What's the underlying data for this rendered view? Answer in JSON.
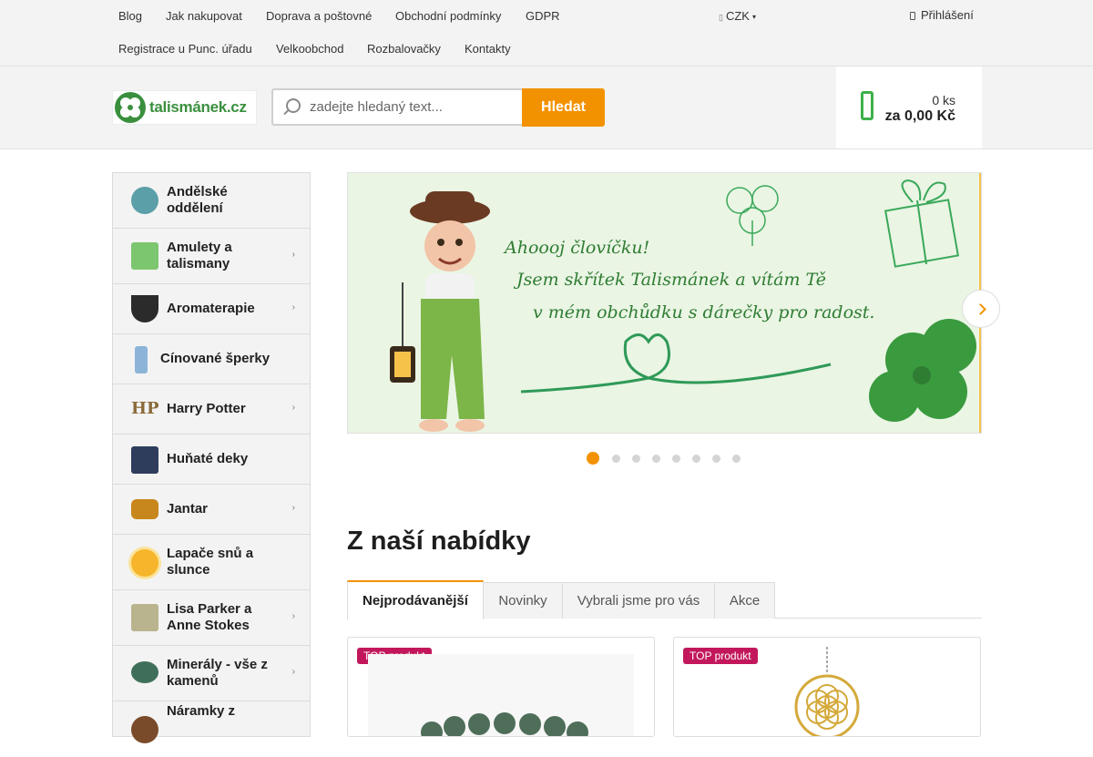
{
  "topnav": {
    "links": [
      "Blog",
      "Jak nakupovat",
      "Doprava a poštovné",
      "Obchodní podmínky",
      "GDPR",
      "Registrace u Punc. úřadu",
      "Velkoobchod",
      "Rozbalovačky",
      "Kontakty"
    ]
  },
  "currency": {
    "label": "CZK"
  },
  "login": {
    "label": "Přihlášení"
  },
  "logo": {
    "text": "talismánek.cz"
  },
  "search": {
    "placeholder": "zadejte hledaný text...",
    "button_label": "Hledat"
  },
  "cart": {
    "quantity": "0 ks",
    "total": "za 0,00 Kč"
  },
  "categories": [
    {
      "label_line1": "Andělské",
      "label_line2": "oddělení",
      "has_submenu": false
    },
    {
      "label_line1": "Amulety a",
      "label_line2": "talismany",
      "has_submenu": true
    },
    {
      "label_line1": "Aromaterapie",
      "label_line2": "",
      "has_submenu": true
    },
    {
      "label_line1": "Cínované šperky",
      "label_line2": "",
      "has_submenu": false
    },
    {
      "label_line1": "Harry Potter",
      "label_line2": "",
      "has_submenu": true
    },
    {
      "label_line1": "Huňaté deky",
      "label_line2": "",
      "has_submenu": false
    },
    {
      "label_line1": "Jantar",
      "label_line2": "",
      "has_submenu": true
    },
    {
      "label_line1": "Lapače snů a",
      "label_line2": "slunce",
      "has_submenu": false
    },
    {
      "label_line1": "Lisa Parker a",
      "label_line2": "Anne Stokes",
      "has_submenu": true
    },
    {
      "label_line1": "Minerály - vše z",
      "label_line2": "kamenů",
      "has_submenu": true
    },
    {
      "label_line1": "Náramky z",
      "label_line2": "",
      "has_submenu": false
    }
  ],
  "banner": {
    "line1": "Ahoooj človíčku!",
    "line2": "Jsem skřítek Talismánek a vítám Tě",
    "line3": "v mém obchůdku s dárečky pro radost.",
    "slide_count": 8,
    "active_slide": 1
  },
  "offer": {
    "title": "Z naší nabídky",
    "tabs": [
      "Nejprodávanější",
      "Novinky",
      "Vybrali jsme pro vás",
      "Akce"
    ],
    "active_tab": 0
  },
  "products": [
    {
      "badge": "TOP produkt"
    },
    {
      "badge": "TOP produkt"
    }
  ],
  "colors": {
    "accent": "#f39200",
    "brand_green": "#3a8f3e",
    "badge": "#c2185b"
  }
}
